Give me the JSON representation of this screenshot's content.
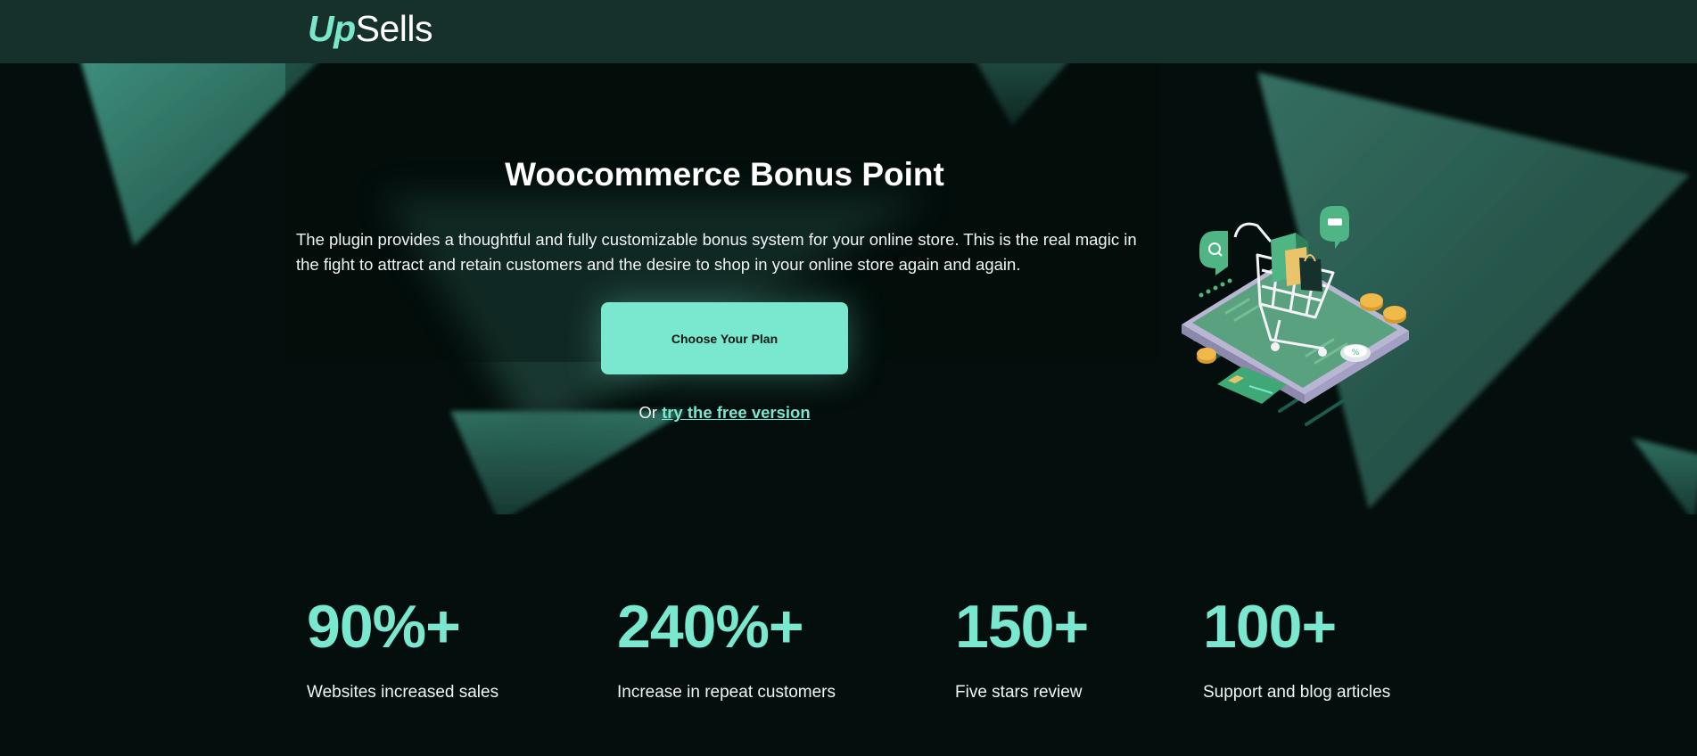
{
  "header": {
    "logo_up": "Up",
    "logo_sells": "Sells"
  },
  "hero": {
    "title": "Woocommerce Bonus Point",
    "description": "The plugin provides a thoughtful and fully customizable bonus system for your online store. This is the real magic in the fight to attract and retain customers and the desire to shop in your online store again and again.",
    "cta_label": "Choose Your Plan",
    "alt_prefix": "Or",
    "alt_link": "try the free version",
    "illustration_icon": "shopping-cart-smartphone-illustration"
  },
  "stats": [
    {
      "value": "90%+",
      "label": "Websites increased sales"
    },
    {
      "value": "240%+",
      "label": "Increase in repeat customers"
    },
    {
      "value": "150+",
      "label": "Five stars review"
    },
    {
      "value": "100+",
      "label": "Support and blog articles"
    }
  ],
  "colors": {
    "accent": "#79e8cf",
    "header_bg": "#16302c",
    "page_bg": "#040e0c",
    "triangle": "#2f6e60"
  }
}
